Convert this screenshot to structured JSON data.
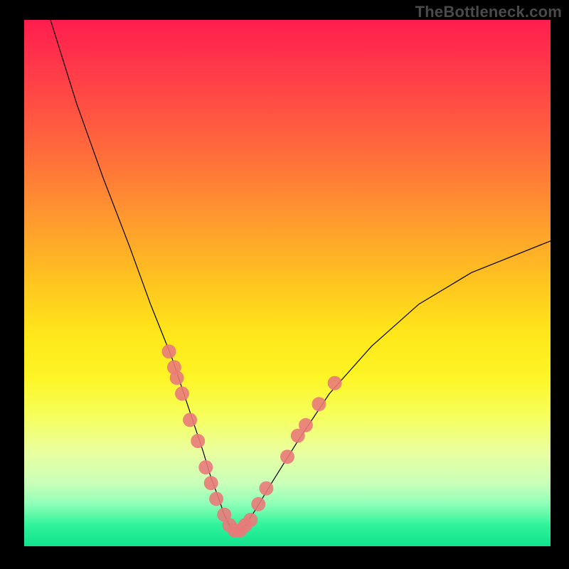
{
  "watermark": "TheBottleneck.com",
  "chart_data": {
    "type": "line",
    "title": "",
    "xlabel": "",
    "ylabel": "",
    "xlim": [
      0,
      100
    ],
    "ylim": [
      0,
      100
    ],
    "series": [
      {
        "name": "curve",
        "x": [
          5,
          10,
          15,
          20,
          24,
          28,
          30,
          32,
          34,
          35.5,
          37,
          38,
          39,
          40,
          41,
          42,
          44,
          47,
          52,
          58,
          66,
          75,
          85,
          100
        ],
        "y": [
          100,
          84,
          70,
          57,
          46,
          36,
          30,
          24,
          18,
          13,
          9,
          6,
          4,
          3,
          3,
          4,
          7,
          12,
          20,
          29,
          38,
          46,
          52,
          58
        ]
      }
    ],
    "markers": [
      {
        "x": 27.5,
        "y": 37
      },
      {
        "x": 28.5,
        "y": 34
      },
      {
        "x": 29.0,
        "y": 32
      },
      {
        "x": 30.0,
        "y": 29
      },
      {
        "x": 31.5,
        "y": 24
      },
      {
        "x": 33.0,
        "y": 20
      },
      {
        "x": 34.5,
        "y": 15
      },
      {
        "x": 35.5,
        "y": 12
      },
      {
        "x": 36.5,
        "y": 9
      },
      {
        "x": 38.0,
        "y": 6
      },
      {
        "x": 39.0,
        "y": 4
      },
      {
        "x": 40.0,
        "y": 3
      },
      {
        "x": 41.0,
        "y": 3
      },
      {
        "x": 42.0,
        "y": 4
      },
      {
        "x": 43.0,
        "y": 5
      },
      {
        "x": 44.5,
        "y": 8
      },
      {
        "x": 46.0,
        "y": 11
      },
      {
        "x": 50.0,
        "y": 17
      },
      {
        "x": 52.0,
        "y": 21
      },
      {
        "x": 53.5,
        "y": 23
      },
      {
        "x": 56.0,
        "y": 27
      },
      {
        "x": 59.0,
        "y": 31
      }
    ],
    "legend": false,
    "grid": false
  }
}
